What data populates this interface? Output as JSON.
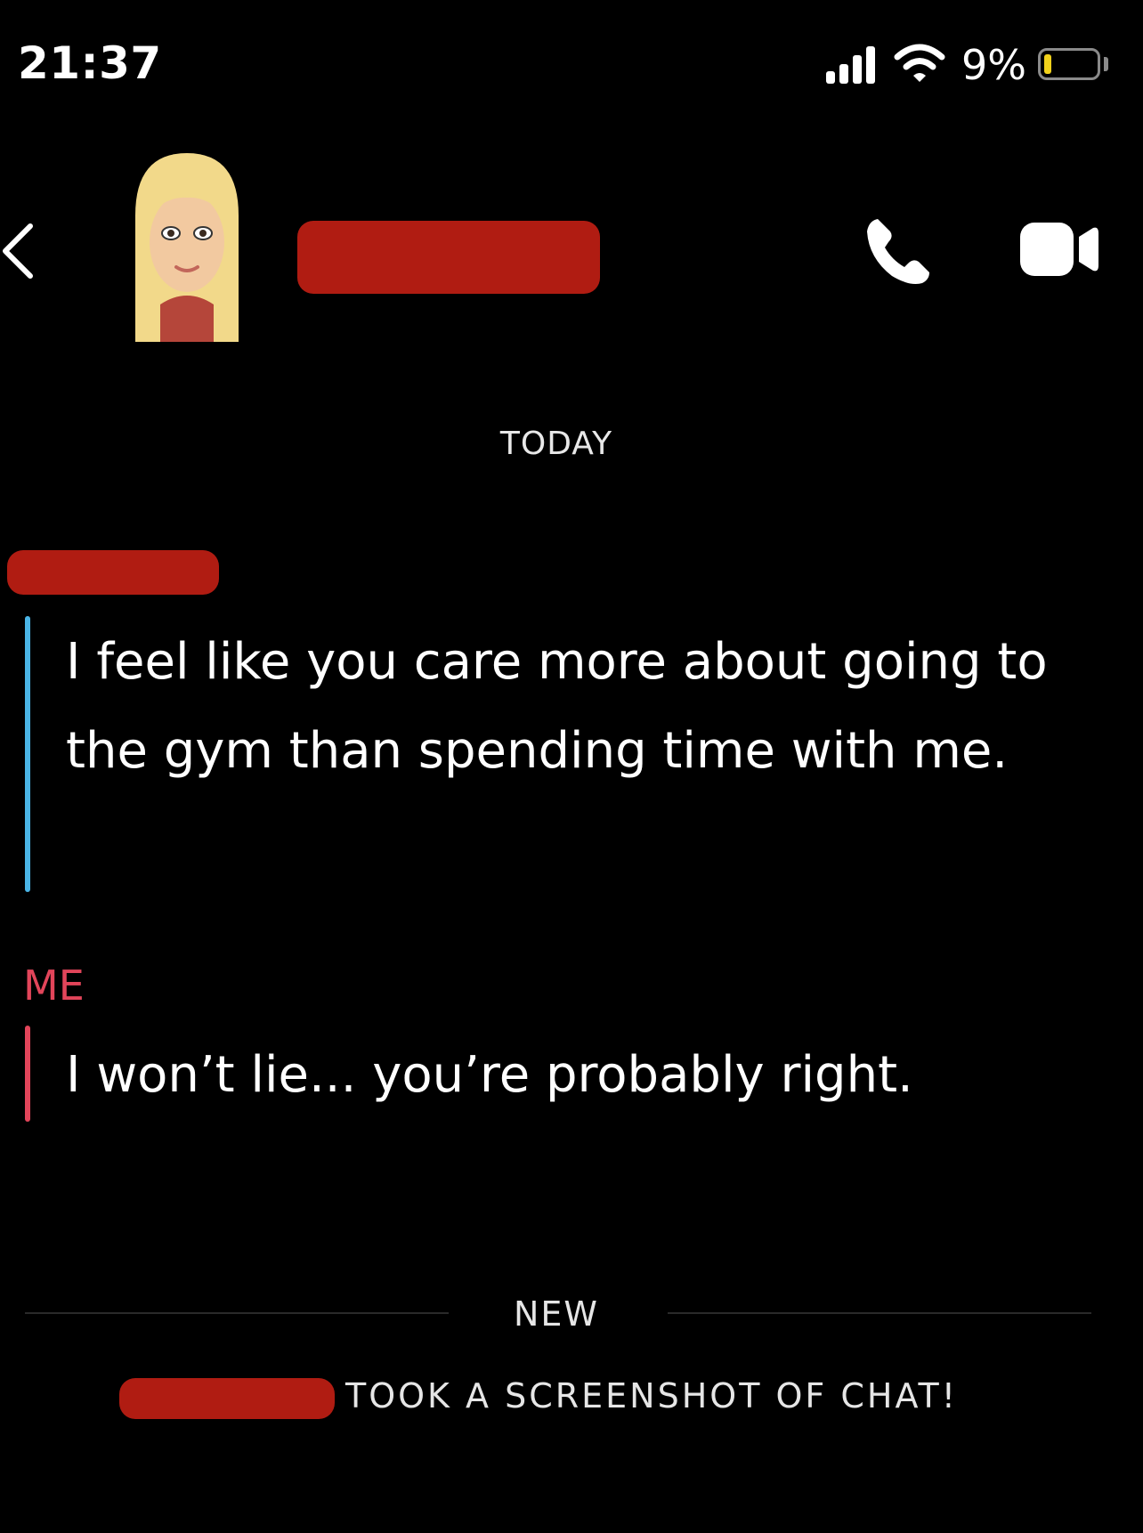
{
  "status_bar": {
    "time": "21:37",
    "battery_percent": "9%",
    "battery_level": 0.09,
    "battery_color": "#f2d21b"
  },
  "header": {
    "contact_name_redacted": true,
    "icons": [
      "back-icon",
      "avatar",
      "phone-icon",
      "video-icon"
    ]
  },
  "chat": {
    "date_separator": "TODAY",
    "messages": [
      {
        "sender_redacted": true,
        "accent_color": "#4ab4e6",
        "text": "I feel like you care more about going to the gym than spending time with me."
      },
      {
        "sender": "ME",
        "accent_color": "#e2455a",
        "text": "I won’t lie... you’re probably right."
      }
    ],
    "new_separator": "NEW",
    "system_note": "TOOK A SCREENSHOT OF CHAT!"
  },
  "colors": {
    "background": "#000000",
    "redaction": "#b01c12"
  }
}
